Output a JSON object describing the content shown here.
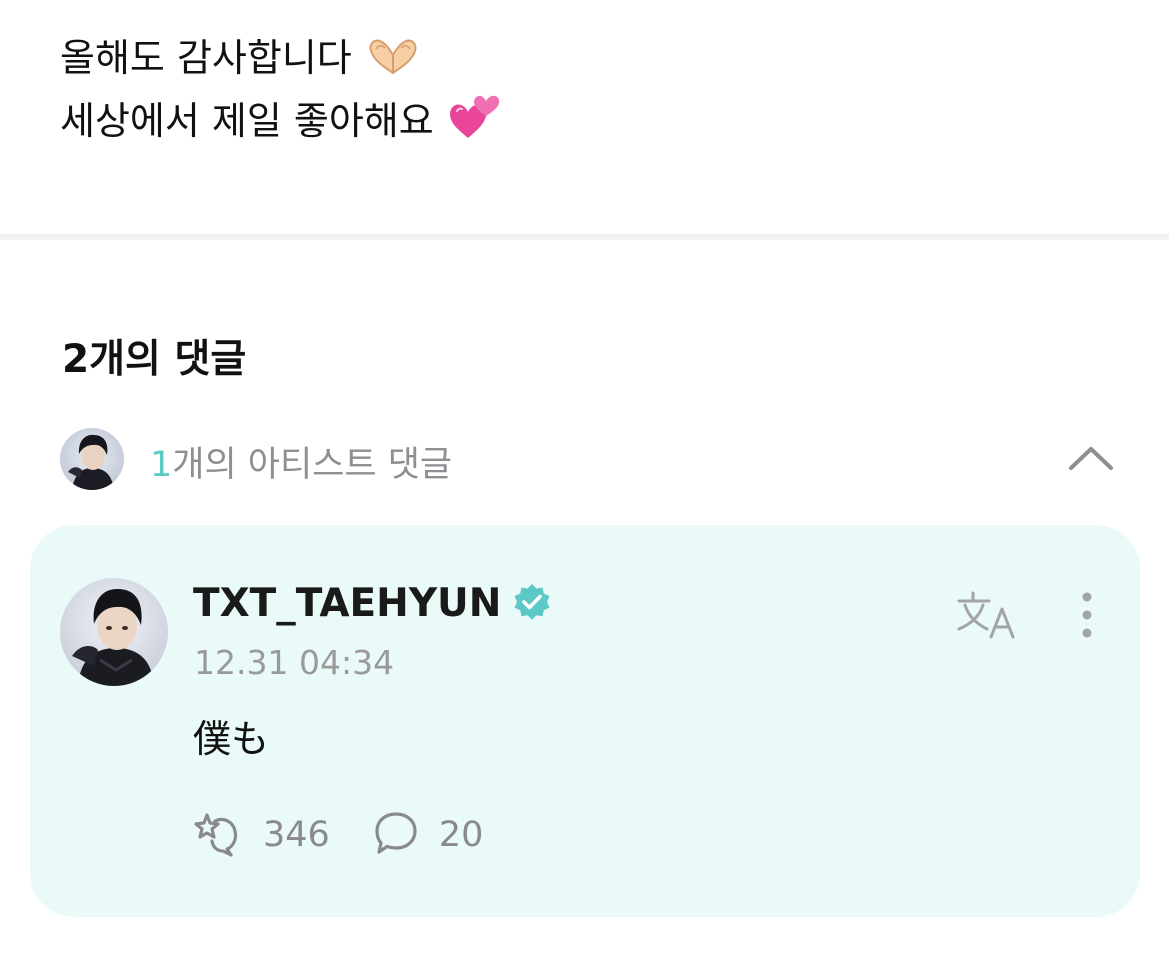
{
  "post": {
    "line1": "올해도 감사합니다",
    "line1_emoji": "heart-hands-emoji",
    "line2": "세상에서 제일 좋아해요",
    "line2_emoji": "two-hearts-emoji"
  },
  "comments": {
    "count_label": "2개의 댓글"
  },
  "artist_summary": {
    "count": "1",
    "label": "개의 아티스트 댓글",
    "toggle_icon": "chevron-up-icon"
  },
  "comment": {
    "author": "TXT_TAEHYUN",
    "verified_icon": "verified-badge-icon",
    "timestamp": "12.31 04:34",
    "text": "僕も",
    "translate_icon": "translate-icon",
    "more_icon": "more-vertical-icon",
    "likes": "346",
    "replies": "20"
  },
  "colors": {
    "accent": "#5cc9c6",
    "card_background": "#eafaf8",
    "muted_text": "#8e8e93"
  }
}
